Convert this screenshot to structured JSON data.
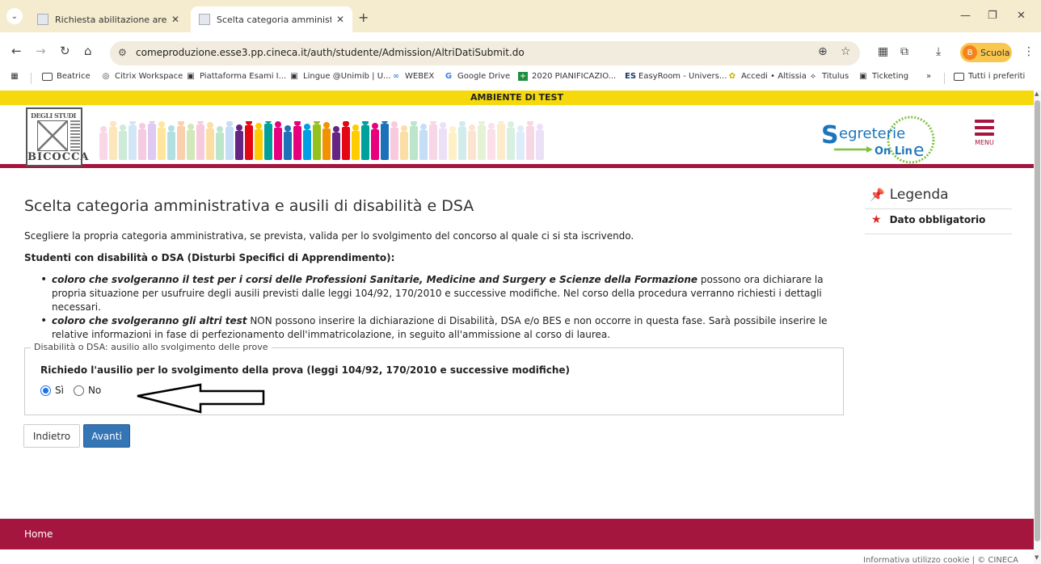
{
  "browser": {
    "tabs": [
      {
        "title": "Richiesta abilitazione area test",
        "active": false
      },
      {
        "title": "Scelta categoria amministrativa",
        "active": true
      }
    ],
    "new_tab": "+",
    "url": "comeproduzione.esse3.pp.cineca.it/auth/studente/Admission/AltriDatiSubmit.do",
    "profile_initial": "B",
    "profile_name": "Scuola",
    "bookmarks": [
      "Beatrice",
      "Citrix Workspace",
      "Piattaforma Esami I...",
      "Lingue @Unimib | U...",
      "WEBEX",
      "Google Drive",
      "2020 PIANIFICAZIO...",
      "EasyRoom - Univers...",
      "Accedi • Altissia",
      "Titulus",
      "Ticketing"
    ],
    "bookmarks_overflow": "»",
    "all_bookmarks": "Tutti i preferiti"
  },
  "page": {
    "test_banner": "AMBIENTE DI TEST",
    "logo": {
      "top": "DEGLI STUDI",
      "bottom": "BICOCCA"
    },
    "menu_label": "MENU",
    "title": "Scelta categoria amministrativa e ausili di disabilità e DSA",
    "intro": "Scegliere la propria categoria amministrativa, se prevista, valida per lo svolgimento del concorso al quale ci si sta iscrivendo.",
    "section_heading": "Studenti con disabilità o DSA (Disturbi Specifici di Apprendimento):",
    "bullets": [
      {
        "bold": "coloro che svolgeranno il test per i corsi delle Professioni Sanitarie, Medicine and Surgery e Scienze della Formazione",
        "text": " possono ora dichiarare la propria situazione per usufruire degli ausili previsti dalle leggi 104/92, 170/2010 e successive modifiche. Nel corso della procedura verranno richiesti i dettagli necessari."
      },
      {
        "bold": "coloro che svolgeranno gli altri test",
        "text": " NON possono inserire la dichiarazione di Disabilità, DSA e/o BES e non occorre in questa fase. Sarà possibile inserire le relative informazioni in fase di perfezionamento dell'immatricolazione, in seguito all'ammissione al corso di laurea."
      }
    ],
    "fieldset_legend": "Disabilità o DSA: ausilio allo svolgimento delle prove",
    "question": "Richiedo l'ausilio per lo svolgimento della prova (leggi 104/92, 170/2010 e successive modifiche)",
    "options": [
      {
        "label": "Sì",
        "selected": true
      },
      {
        "label": "No",
        "selected": false
      }
    ],
    "back_button": "Indietro",
    "next_button": "Avanti"
  },
  "legend_panel": {
    "title": "Legenda",
    "items": [
      {
        "symbol": "★",
        "label": "Dato obbligatorio"
      }
    ]
  },
  "footer": {
    "home": "Home",
    "cookie": "Informativa utilizzo cookie | © CINECA"
  },
  "colors": {
    "brand": "#a5163f",
    "test_banner": "#f5d90d",
    "primary_button": "#3475b6",
    "required_star": "#d9281e"
  }
}
